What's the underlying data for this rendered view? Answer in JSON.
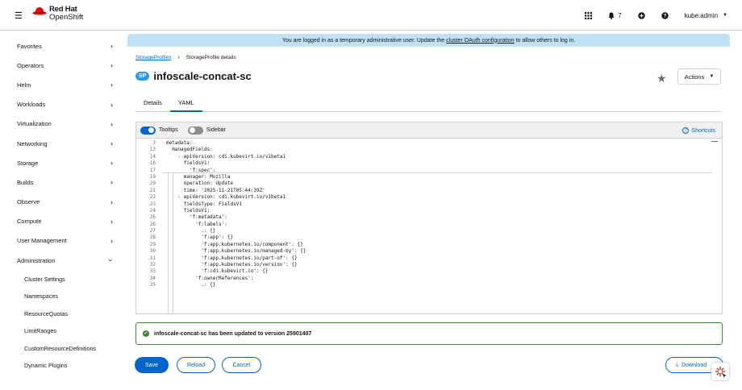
{
  "masthead": {
    "brand_line1": "Red Hat",
    "brand_line2": "OpenShift",
    "notifications_count": "7",
    "user": "kube:admin"
  },
  "sidebar": {
    "items": [
      {
        "label": "Favorites"
      },
      {
        "label": "Operators"
      },
      {
        "label": "Helm"
      },
      {
        "label": "Workloads"
      },
      {
        "label": "Virtualization"
      },
      {
        "label": "Networking"
      },
      {
        "label": "Storage"
      },
      {
        "label": "Builds"
      },
      {
        "label": "Observe"
      },
      {
        "label": "Compute"
      },
      {
        "label": "User Management"
      },
      {
        "label": "Administration"
      }
    ],
    "sub_items": [
      {
        "label": "Cluster Settings"
      },
      {
        "label": "Namespaces"
      },
      {
        "label": "ResourceQuotas"
      },
      {
        "label": "LimitRanges"
      },
      {
        "label": "CustomResourceDefinitions"
      },
      {
        "label": "Dynamic Plugins"
      }
    ]
  },
  "banner": {
    "before": "You are logged in as a temporary administrative user. Update the",
    "link": "cluster OAuth configuration",
    "after": "to allow others to log in."
  },
  "breadcrumb": {
    "parent": "StorageProfiles",
    "current": "StorageProfile details"
  },
  "page": {
    "badge": "SP",
    "title": "infoscale-concat-sc",
    "actions_label": "Actions"
  },
  "tabs": [
    {
      "label": "Details"
    },
    {
      "label": "YAML"
    }
  ],
  "editor": {
    "tooltips_label": "Tooltips",
    "sidebar_label": "Sidebar",
    "shortcuts_label": "Shortcuts",
    "lines": [
      {
        "n": "3",
        "text": "metadata:"
      },
      {
        "n": "13",
        "text": "  managedFields:"
      },
      {
        "n": "14",
        "text": "    - apiVersion: cdi.kubevirt.io/v1beta1"
      },
      {
        "n": "16",
        "text": "      fieldsV1:"
      },
      {
        "n": "17",
        "text": "        'f:spec':"
      },
      {
        "n": "19",
        "text": "      manager: Mozilla"
      },
      {
        "n": "20",
        "text": "      operation: Update"
      },
      {
        "n": "21",
        "text": "      time: '2025-11-21T05:44:39Z'"
      },
      {
        "n": "22",
        "text": "    - apiVersion: cdi.kubevirt.io/v1beta1"
      },
      {
        "n": "23",
        "text": "      fieldsType: FieldsV1"
      },
      {
        "n": "24",
        "text": "      fieldsV1:"
      },
      {
        "n": "25",
        "text": "        'f:metadata':"
      },
      {
        "n": "26",
        "text": "          'f:labels':"
      },
      {
        "n": "27",
        "text": "            .: {}"
      },
      {
        "n": "28",
        "text": "            'f:app': {}"
      },
      {
        "n": "29",
        "text": "            'f:app.kubernetes.io/component': {}"
      },
      {
        "n": "30",
        "text": "            'f:app.kubernetes.io/managed-by': {}"
      },
      {
        "n": "31",
        "text": "            'f:app.kubernetes.io/part-of': {}"
      },
      {
        "n": "32",
        "text": "            'f:app.kubernetes.io/version': {}"
      },
      {
        "n": "33",
        "text": "            'f:cdi.kubevirt.io': {}"
      },
      {
        "n": "34",
        "text": "          'f:ownerReferences':"
      },
      {
        "n": "35",
        "text": "            .: {}"
      }
    ]
  },
  "alert": {
    "message": "infoscale-concat-sc has been updated to version 25901407"
  },
  "buttons": {
    "save": "Save",
    "reload": "Reload",
    "cancel": "Cancel",
    "download": "Download"
  }
}
